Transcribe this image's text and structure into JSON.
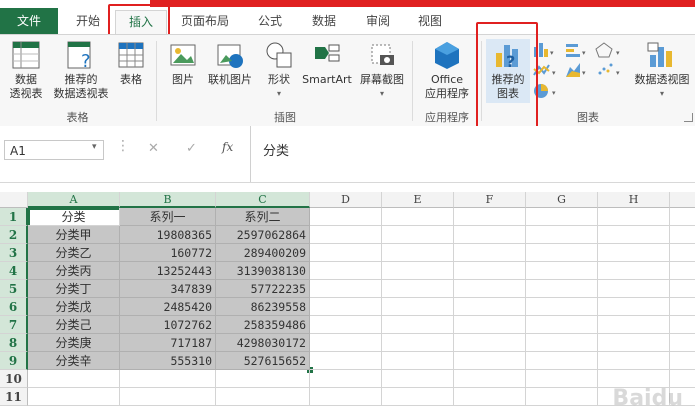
{
  "tabs": [
    "文件",
    "开始",
    "插入",
    "页面布局",
    "公式",
    "数据",
    "审阅",
    "视图"
  ],
  "ribbon": {
    "groups": {
      "tables": {
        "label": "表格",
        "buttons": [
          "数据\n透视表",
          "推荐的\n数据透视表",
          "表格"
        ]
      },
      "illustrations": {
        "label": "插图",
        "buttons": [
          "图片",
          "联机图片",
          "形状",
          "SmartArt",
          "屏幕截图"
        ]
      },
      "apps": {
        "label": "应用程序",
        "buttons": [
          "Office\n应用程序"
        ]
      },
      "charts": {
        "label": "图表",
        "buttons": [
          "推荐的\n图表",
          "数据透视图"
        ]
      }
    }
  },
  "formula_bar": {
    "name_box": "A1",
    "cancel": "✕",
    "enter": "✓",
    "fx": "fx",
    "value": "分类"
  },
  "columns": [
    "A",
    "B",
    "C",
    "D",
    "E",
    "F",
    "G",
    "H"
  ],
  "rows": [
    "1",
    "2",
    "3",
    "4",
    "5",
    "6",
    "7",
    "8",
    "9",
    "10",
    "11"
  ],
  "table": {
    "header": [
      "分类",
      "系列一",
      "系列二"
    ],
    "data": [
      [
        "分类甲",
        "19808365",
        "2597062864"
      ],
      [
        "分类乙",
        "160772",
        "289400209"
      ],
      [
        "分类丙",
        "13252443",
        "3139038130"
      ],
      [
        "分类丁",
        "347839",
        "57722235"
      ],
      [
        "分类戊",
        "2485420",
        "86239558"
      ],
      [
        "分类己",
        "1072762",
        "258359486"
      ],
      [
        "分类庚",
        "717187",
        "4298030172"
      ],
      [
        "分类辛",
        "555310",
        "527615652"
      ]
    ]
  },
  "colors": {
    "accent": "#217346",
    "highlight": "#e02020",
    "selection": "#c6c6c6"
  }
}
